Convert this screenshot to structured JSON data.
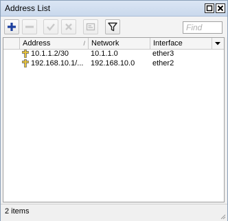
{
  "window": {
    "title": "Address List"
  },
  "titlebar": {
    "restore_icon": "restore-icon",
    "close_icon": "close-icon"
  },
  "toolbar": {
    "buttons": [
      {
        "name": "add-button",
        "icon": "plus-icon",
        "enabled": true
      },
      {
        "name": "remove-button",
        "icon": "minus-icon",
        "enabled": false
      },
      {
        "name": "enable-button",
        "icon": "check-icon",
        "enabled": false
      },
      {
        "name": "disable-button",
        "icon": "cross-icon",
        "enabled": false
      },
      {
        "name": "comment-button",
        "icon": "comment-icon",
        "enabled": false
      },
      {
        "name": "filter-button",
        "icon": "filter-icon",
        "enabled": true
      }
    ],
    "find_placeholder": "Find"
  },
  "table": {
    "columns": [
      {
        "label": "Address",
        "sort": "/"
      },
      {
        "label": "Network",
        "sort": ""
      },
      {
        "label": "Interface",
        "sort": ""
      }
    ],
    "rows": [
      {
        "address": "10.1.1.2/30",
        "network": "10.1.1.0",
        "interface": "ether3"
      },
      {
        "address": "192.168.10.1/...",
        "network": "192.168.10.0",
        "interface": "ether2"
      }
    ],
    "row_icon": "address-plus-icon",
    "menu_icon": "column-menu-arrow-icon"
  },
  "status": {
    "items_text": "2 items"
  },
  "colors": {
    "accent_blue": "#1c3f9e",
    "icon_yellow": "#e6c23a"
  }
}
